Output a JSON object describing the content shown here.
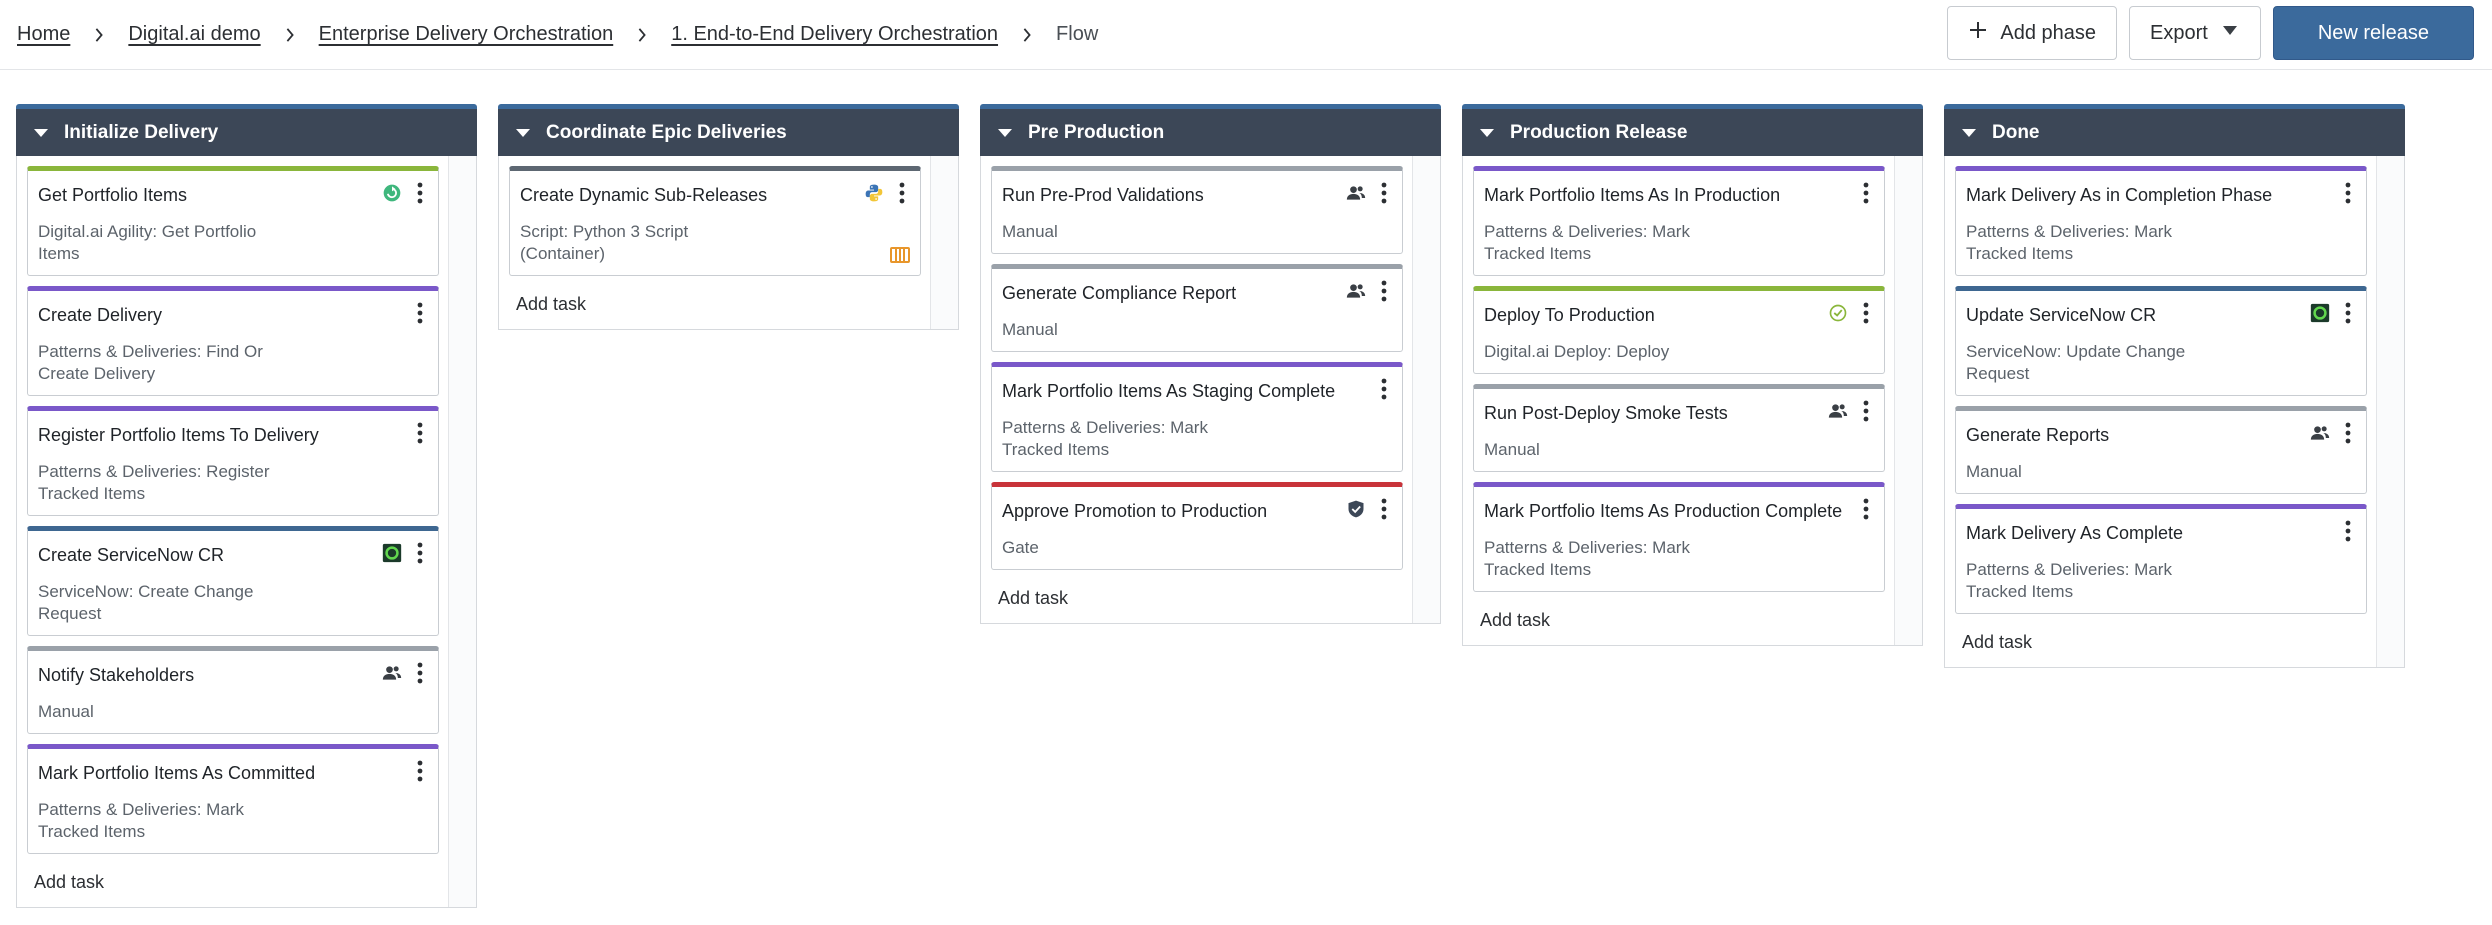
{
  "breadcrumb": {
    "home": "Home",
    "folder": "Digital.ai demo",
    "subfolder": "Enterprise Delivery Orchestration",
    "release": "1. End-to-End Delivery Orchestration",
    "current": "Flow"
  },
  "actions": {
    "add_phase": "Add phase",
    "export": "Export",
    "new_release": "New release"
  },
  "add_task_label": "Add task",
  "phases": [
    {
      "title": "Initialize Delivery",
      "tasks": [
        {
          "title": "Get Portfolio Items",
          "subtitle": "Digital.ai Agility: Get Portfolio Items",
          "color": "#8ab63b",
          "icon": "agility-icon"
        },
        {
          "title": "Create Delivery",
          "subtitle": "Patterns & Deliveries: Find Or Create Delivery",
          "color": "#7a58c9",
          "icon": ""
        },
        {
          "title": "Register Portfolio Items To Delivery",
          "subtitle": "Patterns & Deliveries: Register Tracked Items",
          "color": "#7a58c9",
          "icon": ""
        },
        {
          "title": "Create ServiceNow CR",
          "subtitle": "ServiceNow: Create Change Request",
          "color": "#3e6791",
          "icon": "servicenow-icon"
        },
        {
          "title": "Notify Stakeholders",
          "subtitle": "Manual",
          "color": "#9aa1a9",
          "icon": "users-icon"
        },
        {
          "title": "Mark Portfolio Items As Committed",
          "subtitle": "Patterns & Deliveries: Mark Tracked Items",
          "color": "#7a58c9",
          "icon": ""
        }
      ]
    },
    {
      "title": "Coordinate Epic Deliveries",
      "tasks": [
        {
          "title": "Create Dynamic Sub-Releases",
          "subtitle": "Script: Python 3 Script (Container)",
          "color": "#5d6772",
          "icon": "python-icon"
        }
      ]
    },
    {
      "title": "Pre Production",
      "tasks": [
        {
          "title": "Run Pre-Prod Validations",
          "subtitle": "Manual",
          "color": "#9aa1a9",
          "icon": "users-icon"
        },
        {
          "title": "Generate Compliance Report",
          "subtitle": "Manual",
          "color": "#9aa1a9",
          "icon": "users-icon"
        },
        {
          "title": "Mark Portfolio Items As Staging Complete",
          "subtitle": "Patterns & Deliveries: Mark Tracked Items",
          "color": "#7a58c9",
          "icon": ""
        },
        {
          "title": "Approve Promotion to Production",
          "subtitle": "Gate",
          "color": "#c8333a",
          "icon": "gate-icon"
        }
      ]
    },
    {
      "title": "Production Release",
      "tasks": [
        {
          "title": "Mark Portfolio Items As In Production",
          "subtitle": "Patterns & Deliveries: Mark Tracked Items",
          "color": "#7a58c9",
          "icon": ""
        },
        {
          "title": "Deploy To Production",
          "subtitle": "Digital.ai Deploy: Deploy",
          "color": "#8ab63b",
          "icon": "deploy-icon"
        },
        {
          "title": "Run Post-Deploy Smoke Tests",
          "subtitle": "Manual",
          "color": "#9aa1a9",
          "icon": "users-icon"
        },
        {
          "title": "Mark Portfolio Items As Production Complete",
          "subtitle": "Patterns & Deliveries: Mark Tracked Items",
          "color": "#7a58c9",
          "icon": ""
        }
      ]
    },
    {
      "title": "Done",
      "tasks": [
        {
          "title": "Mark Delivery As in Completion Phase",
          "subtitle": "Patterns & Deliveries: Mark Tracked Items",
          "color": "#7a58c9",
          "icon": ""
        },
        {
          "title": "Update ServiceNow CR",
          "subtitle": "ServiceNow: Update Change Request",
          "color": "#3e6791",
          "icon": "servicenow-icon"
        },
        {
          "title": "Generate Reports",
          "subtitle": "Manual",
          "color": "#9aa1a9",
          "icon": "users-icon"
        },
        {
          "title": "Mark Delivery As Complete",
          "subtitle": "Patterns & Deliveries: Mark Tracked Items",
          "color": "#7a58c9",
          "icon": ""
        }
      ]
    }
  ]
}
